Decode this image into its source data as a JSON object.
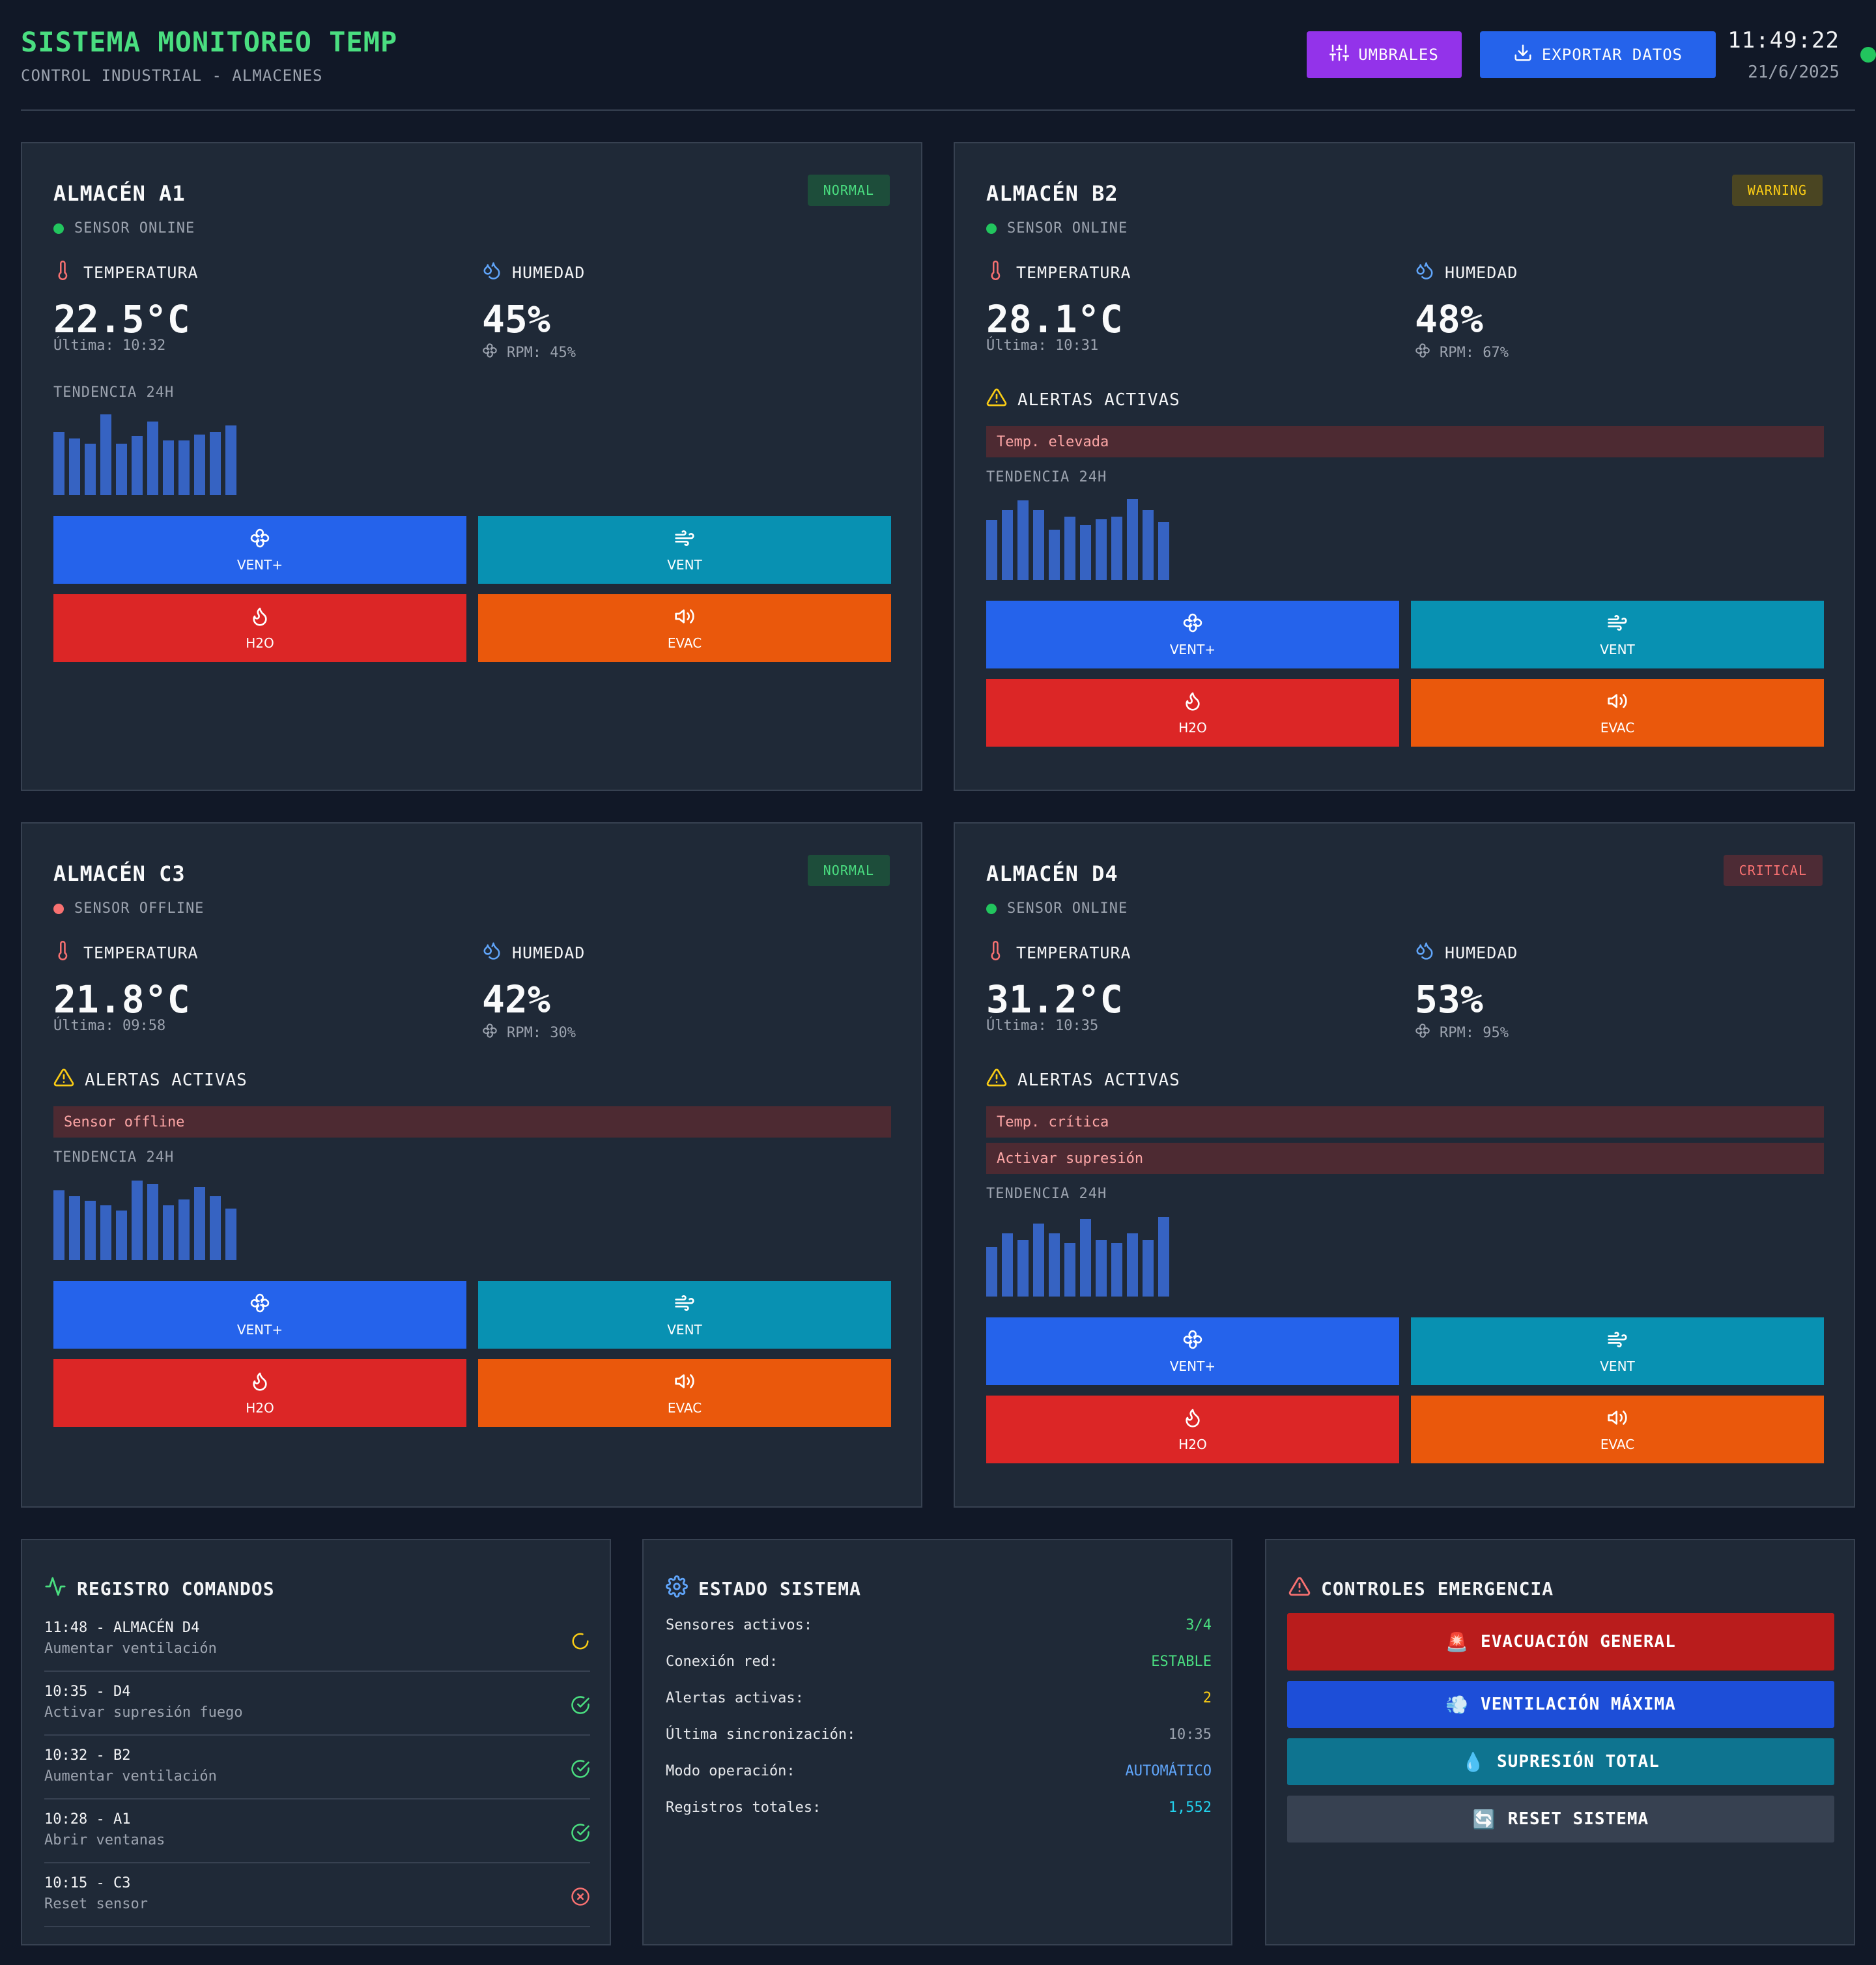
{
  "header": {
    "title": "SISTEMA MONITOREO TEMP",
    "subtitle": "CONTROL INDUSTRIAL - ALMACENES",
    "btn_umbrales": "UMBRALES",
    "btn_export": "EXPORTAR DATOS",
    "time": "11:49:22",
    "date": "21/6/2025"
  },
  "labels": {
    "temperature": "TEMPERATURA",
    "humidity": "HUMEDAD",
    "alerts": "ALERTAS ACTIVAS",
    "trend": "TENDENCIA 24H",
    "act_vent_plus": "VENT+",
    "act_vent": "VENT",
    "act_h2o": "H2O",
    "act_evac": "EVAC"
  },
  "warehouses": [
    {
      "name": "ALMACÉN A1",
      "status": "NORMAL",
      "sensor": "SENSOR ONLINE",
      "temp": "22.5°C",
      "last": "Última: 10:32",
      "humidity": "45%",
      "rpm": "RPM: 45%",
      "alerts": [],
      "trend": [
        0.78,
        0.7,
        0.64,
        1.0,
        0.64,
        0.73,
        0.91,
        0.68,
        0.68,
        0.75,
        0.78,
        0.86
      ]
    },
    {
      "name": "ALMACÉN B2",
      "status": "WARNING",
      "sensor": "SENSOR ONLINE",
      "temp": "28.1°C",
      "last": "Última: 10:31",
      "humidity": "48%",
      "rpm": "RPM: 67%",
      "alerts": [
        "Temp. elevada"
      ],
      "trend": [
        0.74,
        0.86,
        0.98,
        0.86,
        0.62,
        0.78,
        0.68,
        0.75,
        0.78,
        1.0,
        0.86,
        0.72
      ]
    },
    {
      "name": "ALMACÉN C3",
      "status": "NORMAL",
      "sensor": "SENSOR OFFLINE",
      "temp": "21.8°C",
      "last": "Última: 09:58",
      "humidity": "42%",
      "rpm": "RPM: 30%",
      "alerts": [
        "Sensor offline"
      ],
      "trend": [
        0.86,
        0.79,
        0.73,
        0.68,
        0.61,
        0.98,
        0.94,
        0.68,
        0.75,
        0.9,
        0.79,
        0.64
      ]
    },
    {
      "name": "ALMACÉN D4",
      "status": "CRITICAL",
      "sensor": "SENSOR ONLINE",
      "temp": "31.2°C",
      "last": "Última: 10:35",
      "humidity": "53%",
      "rpm": "RPM: 95%",
      "alerts": [
        "Temp. crítica",
        "Activar supresión"
      ],
      "trend": [
        0.61,
        0.78,
        0.7,
        0.9,
        0.78,
        0.66,
        0.96,
        0.7,
        0.66,
        0.78,
        0.7,
        0.98
      ]
    }
  ],
  "log": {
    "title": "REGISTRO COMANDOS",
    "items": [
      {
        "time": "11:48 - ALMACÉN D4",
        "cmd": "Aumentar ventilación",
        "state": "pending"
      },
      {
        "time": "10:35 - D4",
        "cmd": "Activar supresión fuego",
        "state": "ok"
      },
      {
        "time": "10:32 - B2",
        "cmd": "Aumentar ventilación",
        "state": "ok"
      },
      {
        "time": "10:28 - A1",
        "cmd": "Abrir ventanas",
        "state": "ok"
      },
      {
        "time": "10:15 - C3",
        "cmd": "Reset sensor",
        "state": "error"
      }
    ]
  },
  "system": {
    "title": "ESTADO SISTEMA",
    "rows": [
      {
        "k": "Sensores activos:",
        "v": "3/4",
        "color": "#4ade80"
      },
      {
        "k": "Conexión red:",
        "v": "ESTABLE",
        "color": "#4ade80"
      },
      {
        "k": "Alertas activas:",
        "v": "2",
        "color": "#facc15"
      },
      {
        "k": "Última sincronización:",
        "v": "10:35",
        "color": "#9ca3af"
      },
      {
        "k": "Modo operación:",
        "v": "AUTOMÁTICO",
        "color": "#60a5fa"
      },
      {
        "k": "Registros totales:",
        "v": "1,552",
        "color": "#22d3ee"
      }
    ]
  },
  "emergency": {
    "title": "CONTROLES EMERGENCIA",
    "buttons": [
      {
        "label": "EVACUACIÓN GENERAL",
        "emoji": "🚨",
        "color": "#b91c1c"
      },
      {
        "label": "VENTILACIÓN MÁXIMA",
        "emoji": "💨",
        "color": "#1d4ed8"
      },
      {
        "label": "SUPRESIÓN TOTAL",
        "emoji": "💧",
        "color": "#0e7490"
      },
      {
        "label": "RESET SISTEMA",
        "emoji": "🔄",
        "color": "#374151"
      }
    ]
  }
}
